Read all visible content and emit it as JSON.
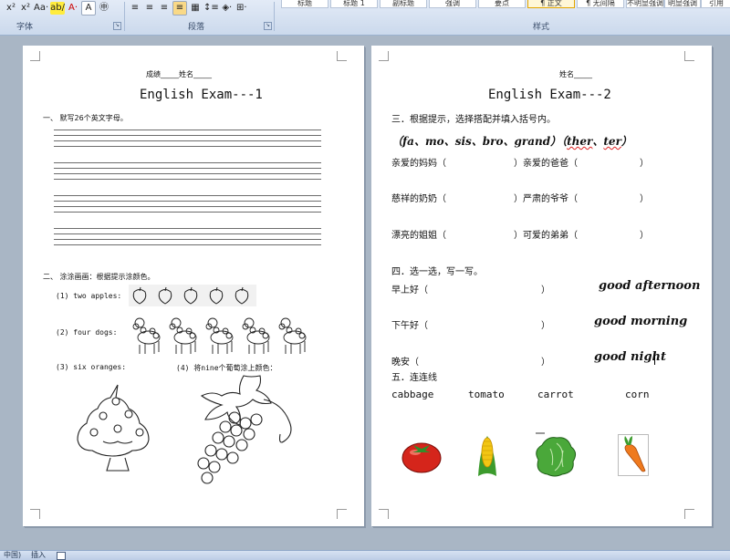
{
  "ribbon": {
    "font_group_label": "字体",
    "paragraph_group_label": "段落",
    "styles_group_label": "样式",
    "font_buttons": [
      "x²",
      "x²",
      "Aa·",
      "ab/",
      "A·",
      "A",
      "㊥"
    ],
    "styles": [
      "标题",
      "标题 1",
      "副标题",
      "强调",
      "要点",
      "¶ 正文",
      "¶ 无间隔",
      "不明显强调",
      "明显强调",
      "引用"
    ]
  },
  "page1": {
    "score_name_line": "成绩_____姓名_____",
    "title": "English  Exam---1",
    "q1": "一、  默写26个英文字母。",
    "q2": "二、  涂涂画画：根据提示涂颜色。",
    "items": {
      "apples": "(1) two apples:",
      "dogs": "(2) four  dogs:",
      "oranges": "(3) six oranges:",
      "nine": "(4) 将nine个葡萄涂上颜色："
    }
  },
  "page2": {
    "name_line": "姓名_____",
    "title": "English  Exam---2",
    "q3": "三．根据提示，选择搭配并填入括号内。",
    "hints_open": "（",
    "hints": [
      "fa",
      "mo",
      "sis",
      "bro",
      "grand"
    ],
    "hints_mid": "）（",
    "hints2": [
      "ther",
      "ter"
    ],
    "hints_close": "）",
    "sep": "、",
    "rows": [
      {
        "left": "亲爱的妈妈（",
        "mid": "）亲爱的爸爸（",
        "right": "）"
      },
      {
        "left": "慈祥的奶奶（",
        "mid": "）严肃的爷爷（",
        "right": "）"
      },
      {
        "left": "漂亮的姐姐（",
        "mid": "）可爱的弟弟（",
        "right": "）"
      }
    ],
    "q4": "四．选一选，写一写。",
    "greet_rows": [
      {
        "label": "早上好（",
        "close": "）",
        "answer": "good afternoon"
      },
      {
        "label": "下午好（",
        "close": "）",
        "answer": "good morning"
      },
      {
        "label": "晚安（",
        "close": "）",
        "answer": "good night"
      }
    ],
    "q5": "五．连连线",
    "words": [
      "cabbage",
      "tomato",
      "carrot",
      "corn"
    ]
  },
  "status": {
    "language": "中国)",
    "mode": "插入"
  },
  "colors": {
    "ribbon_top": "#e3ebf7",
    "background": "#a9b6c5",
    "spell_error": "#d22222"
  }
}
